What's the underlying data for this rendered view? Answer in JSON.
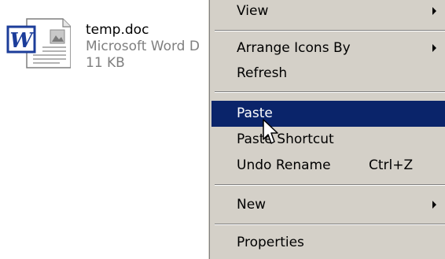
{
  "file": {
    "name": "temp.doc",
    "type": "Microsoft Word D",
    "size": "11 KB",
    "icon": "word-document-icon"
  },
  "context_menu": {
    "items": [
      {
        "label": "View",
        "has_submenu": true
      },
      {
        "label": "Arrange Icons By",
        "has_submenu": true
      },
      {
        "label": "Refresh"
      },
      {
        "label": "Paste",
        "highlighted": true
      },
      {
        "label": "Paste Shortcut"
      },
      {
        "label": "Undo Rename",
        "shortcut": "Ctrl+Z"
      },
      {
        "label": "New",
        "has_submenu": true
      },
      {
        "label": "Properties"
      }
    ],
    "colors": {
      "background": "#d4d0c8",
      "highlight": "#0a246a",
      "highlight_text": "#ffffff"
    }
  },
  "cursor": {
    "icon": "arrow-cursor-icon"
  }
}
